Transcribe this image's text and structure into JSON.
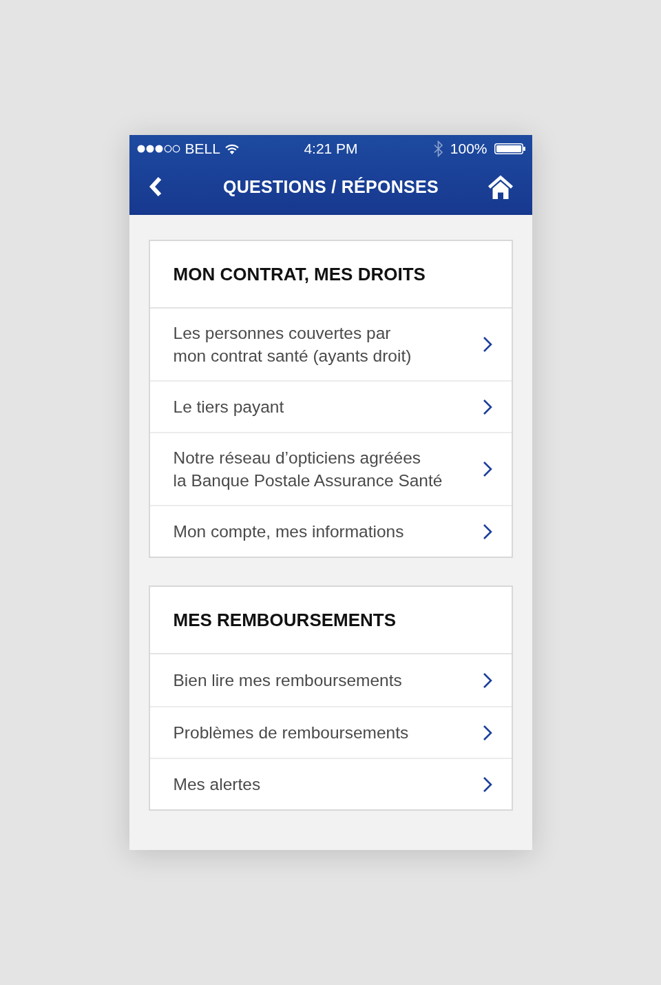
{
  "status_bar": {
    "carrier": "BELL",
    "time": "4:21 PM",
    "battery": "100%"
  },
  "nav_bar": {
    "title": "QUESTIONS / RÉPONSES"
  },
  "sections": [
    {
      "title": "MON CONTRAT, MES DROITS",
      "items": [
        {
          "label": "Les personnes couvertes par\nmon contrat santé (ayants droit)"
        },
        {
          "label": "Le tiers payant"
        },
        {
          "label": "Notre réseau d’opticiens agréées\nla Banque Postale Assurance Santé"
        },
        {
          "label": "Mon compte, mes informations"
        }
      ]
    },
    {
      "title": "MES REMBOURSEMENTS",
      "items": [
        {
          "label": "Bien lire mes remboursements"
        },
        {
          "label": "Problèmes de remboursements"
        },
        {
          "label": "Mes alertes"
        }
      ]
    }
  ]
}
